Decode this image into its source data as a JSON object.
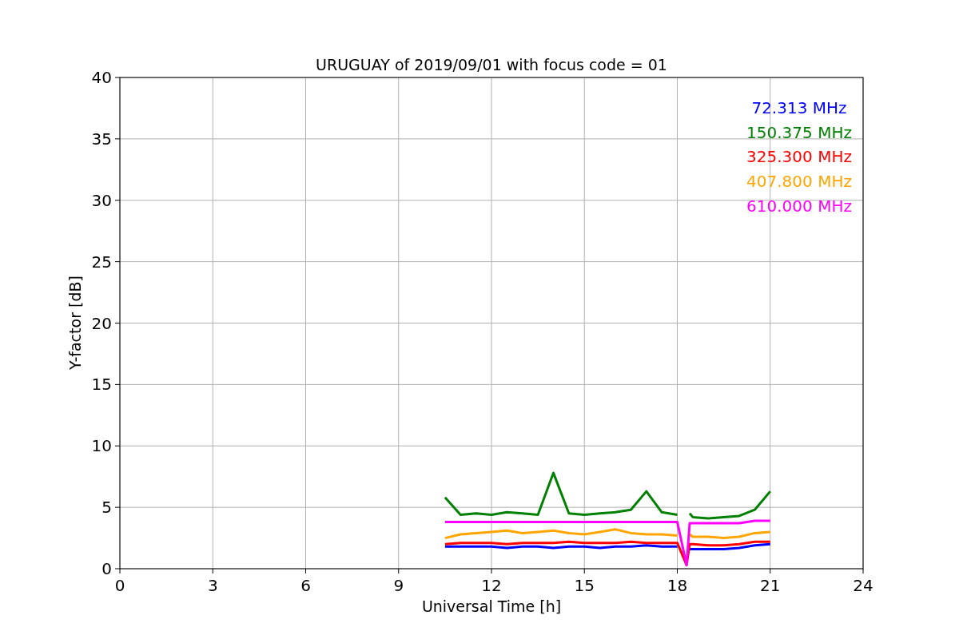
{
  "figure": {
    "chart_data": {
      "type": "line",
      "title": "URUGUAY of 2019/09/01 with focus code = 01",
      "xlabel": "Universal Time [h]",
      "ylabel": "Y-factor [dB]",
      "x": [
        10.5,
        11,
        11.5,
        12,
        12.5,
        13,
        13.5,
        14,
        14.5,
        15,
        15.5,
        16,
        16.5,
        17,
        17.5,
        18,
        18.3,
        18.4,
        18.5,
        19,
        19.5,
        20,
        20.5,
        21
      ],
      "series": [
        {
          "name": "72.313 MHz",
          "color": "#0000ff",
          "values": [
            1.8,
            1.8,
            1.8,
            1.8,
            1.7,
            1.8,
            1.8,
            1.7,
            1.8,
            1.8,
            1.7,
            1.8,
            1.8,
            1.9,
            1.8,
            1.8,
            null,
            1.6,
            1.6,
            1.6,
            1.6,
            1.7,
            1.9,
            2.0
          ]
        },
        {
          "name": "150.375 MHz",
          "color": "#008000",
          "values": [
            5.8,
            4.4,
            4.5,
            4.4,
            4.6,
            4.5,
            4.4,
            7.8,
            4.5,
            4.4,
            4.5,
            4.6,
            4.8,
            6.3,
            4.6,
            4.4,
            null,
            4.5,
            4.2,
            4.1,
            4.2,
            4.3,
            4.8,
            6.3
          ]
        },
        {
          "name": "325.300 MHz",
          "color": "#ff0000",
          "values": [
            2.0,
            2.1,
            2.1,
            2.1,
            2.0,
            2.1,
            2.1,
            2.1,
            2.2,
            2.1,
            2.1,
            2.1,
            2.2,
            2.1,
            2.1,
            2.1,
            0.3,
            2.0,
            2.0,
            1.9,
            1.9,
            2.0,
            2.2,
            2.2
          ]
        },
        {
          "name": "407.800 MHz",
          "color": "#ffa500",
          "values": [
            2.5,
            2.8,
            2.9,
            3.0,
            3.1,
            2.9,
            3.0,
            3.1,
            2.9,
            2.8,
            3.0,
            3.2,
            2.9,
            2.8,
            2.8,
            2.7,
            null,
            2.8,
            2.6,
            2.6,
            2.5,
            2.6,
            2.9,
            3.0
          ]
        },
        {
          "name": "610.000 MHz",
          "color": "#ff00ff",
          "values": [
            3.8,
            3.8,
            3.8,
            3.8,
            3.8,
            3.8,
            3.8,
            3.8,
            3.8,
            3.8,
            3.8,
            3.8,
            3.8,
            3.8,
            3.8,
            3.8,
            0.3,
            3.7,
            3.7,
            3.7,
            3.7,
            3.7,
            3.9,
            3.9
          ]
        }
      ],
      "xlim": [
        0,
        24
      ],
      "ylim": [
        0,
        40
      ],
      "xticks": [
        0,
        3,
        6,
        9,
        12,
        15,
        18,
        21,
        24
      ],
      "yticks": [
        0,
        5,
        10,
        15,
        20,
        25,
        30,
        35,
        40
      ],
      "grid": true
    }
  }
}
